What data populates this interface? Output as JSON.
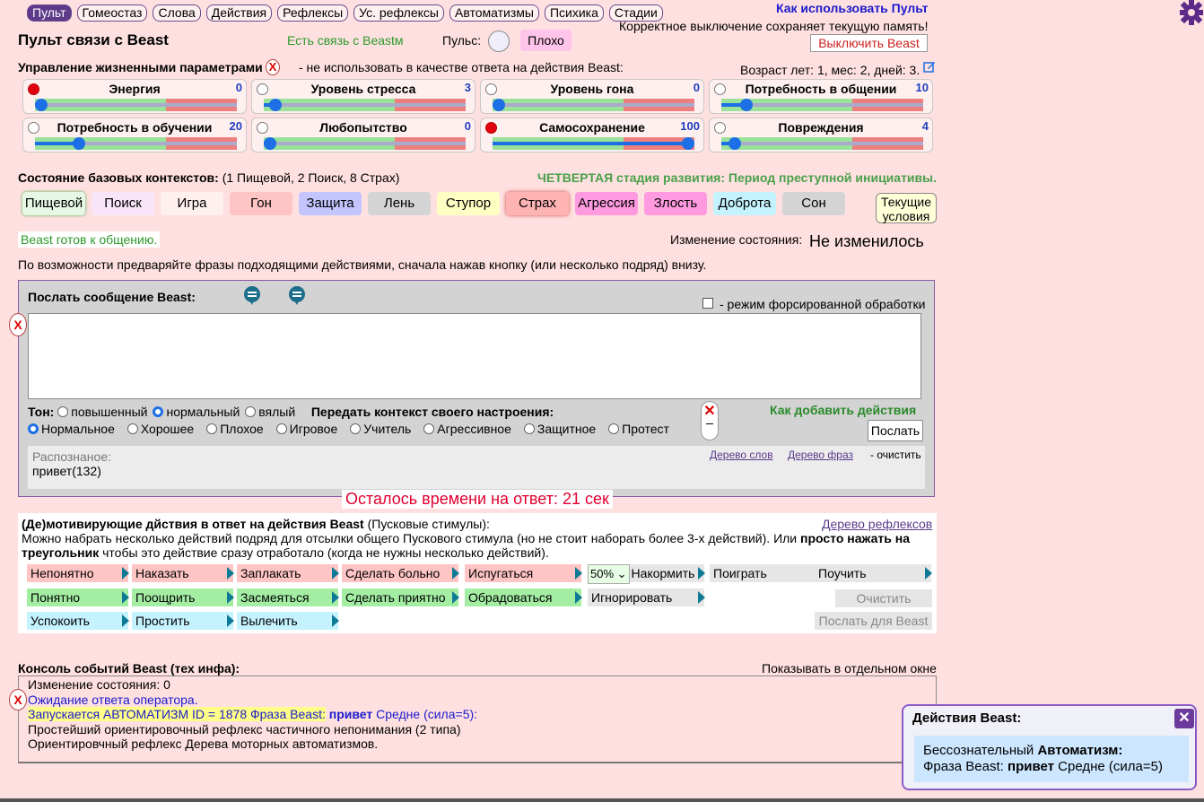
{
  "nav": [
    "Пульт",
    "Гомеостаз",
    "Слова",
    "Действия",
    "Рефлексы",
    "Ус. рефлексы",
    "Автоматизмы",
    "Психика",
    "Стадии"
  ],
  "help_link": "Как использовать Пульт",
  "shutdown_note": "Корректное выключение сохраняет текущую память!",
  "shutdown_btn": "Выключить Beast",
  "title": "Пульт связи с Beast",
  "connection": "Есть связь с Beastм",
  "pulse_label": "Пульс:",
  "pulse_state": "Плохо",
  "params_heading": "Управление жизненными параметрами",
  "params_note": "- не использовать в качестве ответа на действия Beast:",
  "age": "Возраст лет: 1, мес: 2, дней: 3.",
  "params": [
    {
      "name": "Энергия",
      "value": "0",
      "level": 0,
      "dot": "red",
      "good": "left"
    },
    {
      "name": "Уровень стресса",
      "value": "3",
      "level": 3,
      "dot": "white",
      "good": "left"
    },
    {
      "name": "Уровень гона",
      "value": "0",
      "level": 0,
      "dot": "white",
      "good": "left"
    },
    {
      "name": "Потребность в общении",
      "value": "10",
      "level": 10,
      "dot": "white",
      "good": "left"
    },
    {
      "name": "Потребность в обучении",
      "value": "20",
      "level": 20,
      "dot": "white",
      "good": "left"
    },
    {
      "name": "Любопытство",
      "value": "0",
      "level": 0,
      "dot": "white",
      "good": "left"
    },
    {
      "name": "Самосохранение",
      "value": "100",
      "level": 100,
      "dot": "red",
      "good": "left"
    },
    {
      "name": "Повреждения",
      "value": "4",
      "level": 4,
      "dot": "white",
      "good": "left"
    }
  ],
  "contexts_heading": "Состояние базовых контекстов:",
  "contexts_note": "(1 Пищевой, 2 Поиск, 8 Страх)",
  "stage": "ЧЕТВЕРТАЯ стадия развития: Период преступной инициативы.",
  "contexts": [
    {
      "label": "Пищевой",
      "bg": "#e6f7e6"
    },
    {
      "label": "Поиск",
      "bg": "#f8e6f8"
    },
    {
      "label": "Игра",
      "bg": "#fff0f0"
    },
    {
      "label": "Гон",
      "bg": "#ffc4c4"
    },
    {
      "label": "Защита",
      "bg": "#c4c4ff"
    },
    {
      "label": "Лень",
      "bg": "#d4d4d4"
    },
    {
      "label": "Ступор",
      "bg": "#ffffc4"
    },
    {
      "label": "Страх",
      "bg": "#ffb4b4"
    },
    {
      "label": "Агрессия",
      "bg": "#ff9ae0"
    },
    {
      "label": "Злость",
      "bg": "#ff9ae0"
    },
    {
      "label": "Доброта",
      "bg": "#c4f2ff"
    },
    {
      "label": "Сон",
      "bg": "#d4d4d4"
    }
  ],
  "current_conditions": [
    "Текущие",
    "условия"
  ],
  "ready": "Beast готов к общению.",
  "state_change_label": "Изменение состояния:",
  "state_change_value": "Не изменилось",
  "hint": "По возможности предваряйте фразы подходящими действиями, сначала нажав кнопку (или несколько подряд) внизу.",
  "send_label": "Послать сообщение Beast",
  "forced_mode": "- режим форсированной обработки",
  "tone_label": "Тон:",
  "tones": [
    "повышенный",
    "нормальный",
    "вялый"
  ],
  "tone_selected": 1,
  "mood_label": "Передать контекст своего настроения:",
  "moods": [
    "Нормальное",
    "Хорошее",
    "Плохое",
    "Игровое",
    "Учитель",
    "Агрессивное",
    "Защитное",
    "Протест"
  ],
  "mood_selected": 0,
  "add_actions_link": "Как добавить действия",
  "send_btn": "Послать",
  "recognized_label": "Распознаное:",
  "recognized_value": "привет(132)",
  "word_tree": "Дерево слов",
  "phrase_tree": "Дерево фраз",
  "clear_note": "- очистить",
  "timer": "Осталось времени на ответ: 21 сек",
  "motiv_heading": "(Де)мотивирующие дйствия в ответ на действия Beast",
  "motiv_heading_note": "(Пусковые стимулы):",
  "reflex_tree": "Дерево рефлексов",
  "motiv_text1": "Можно набрать несколько действий подряд для отсылки общего Пускового стимула (но не стоит наборать более 3-х действий). Или",
  "motiv_text_bold": "просто нажать на треугольник",
  "motiv_text2": "чтобы это действие сразу отработало (когда не нужны несколько действий).",
  "actions_row1": [
    {
      "label": "Непонятно",
      "bg": "#ffc4c4"
    },
    {
      "label": "Наказать",
      "bg": "#ffc4c4"
    },
    {
      "label": "Заплакать",
      "bg": "#ffc4c4"
    },
    {
      "label": "Сделать больно",
      "bg": "#ffc4c4"
    },
    {
      "label": "Испугаться",
      "bg": "#ffc4c4"
    },
    {
      "label": "Накормить",
      "bg": "#e6e6e6"
    },
    {
      "label": "Поиграть",
      "bg": "#e6e6e6"
    },
    {
      "label": "Поучить",
      "bg": "#e6e6e6"
    }
  ],
  "feed_percent": "50%",
  "actions_row2": [
    {
      "label": "Понятно",
      "bg": "#a4eea4"
    },
    {
      "label": "Поощрить",
      "bg": "#a4eea4"
    },
    {
      "label": "Засмеяться",
      "bg": "#a4eea4"
    },
    {
      "label": "Сделать приятно",
      "bg": "#a4eea4"
    },
    {
      "label": "Обрадоваться",
      "bg": "#a4eea4"
    },
    {
      "label": "Игнорировать",
      "bg": "#e6e6e6"
    }
  ],
  "actions_row3": [
    {
      "label": "Успокоить",
      "bg": "#c4f2ff"
    },
    {
      "label": "Простить",
      "bg": "#c4f2ff"
    },
    {
      "label": "Вылечить",
      "bg": "#c4f2ff"
    }
  ],
  "clear_btn": "Очистить",
  "send_beast_btn": "Послать для Beast",
  "console_heading": "Консоль событий Beast (тех инфа):",
  "console_window": "Показывать в отдельном окне",
  "console": {
    "line1": "Изменение состояния: 0",
    "line2": "Ожидание ответа оператора.",
    "line3_a": "Запускается АВТОМАТИЗМ ID = 1878 Фраза Beast:",
    "line3_b": "привет",
    "line3_c": "Средне (сила=5):",
    "line4": "Простейший ориентировочный рефлекс частичного непонимания (2 типа)",
    "line5": "Ориентировчный рефлекс Дерева моторных автоматизмов."
  },
  "popup": {
    "title": "Действия Beast:",
    "line1_a": "Бессознательный",
    "line1_b": "Автоматизм:",
    "line2_a": "Фраза Beast:",
    "line2_b": "привет",
    "line2_c": "Средне (сила=5)"
  }
}
